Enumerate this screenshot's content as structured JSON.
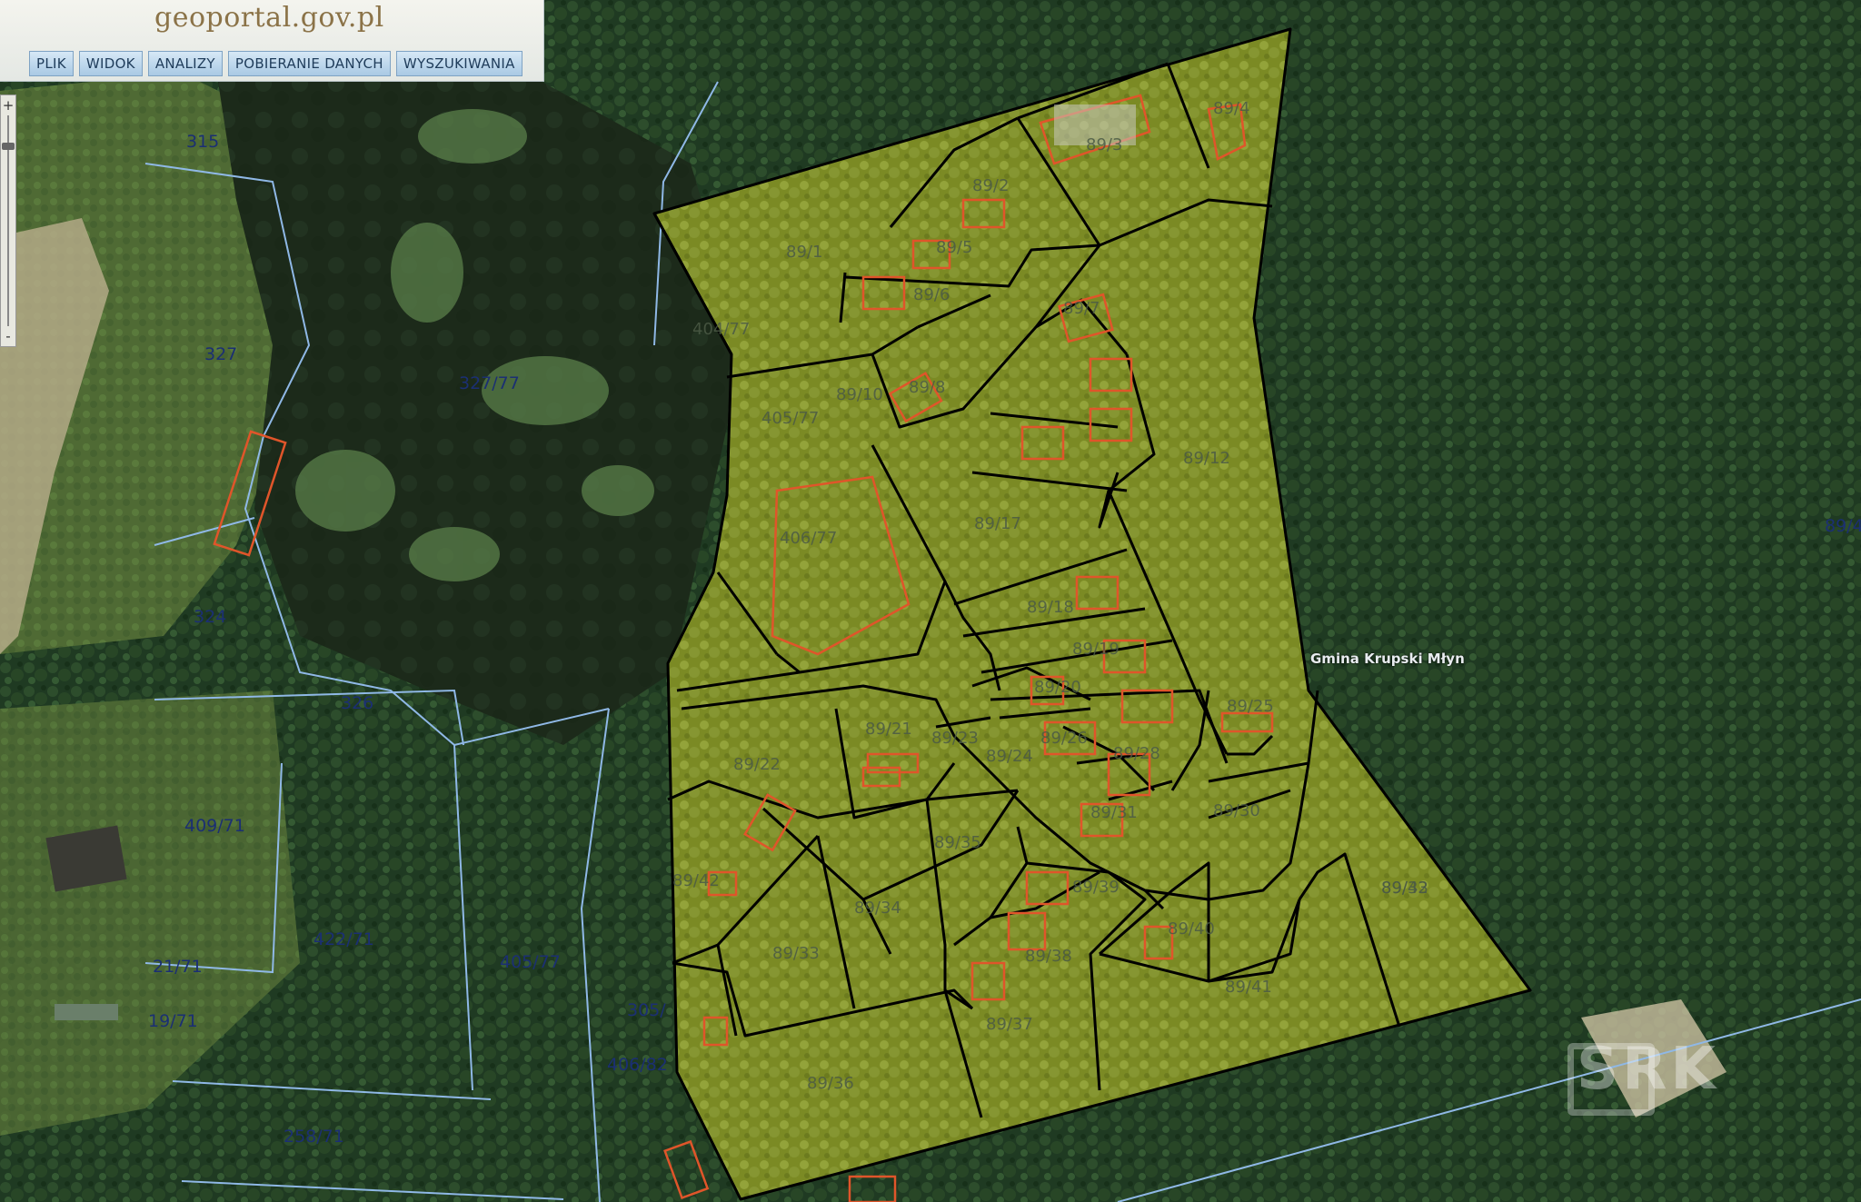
{
  "app": {
    "logo_text": "geoportal.gov.pl",
    "menu": [
      "PLIK",
      "WIDOK",
      "ANALIZY",
      "POBIERANIE DANYCH",
      "WYSZUKIWANIA"
    ],
    "zoom_in": "+",
    "zoom_out": "-"
  },
  "map": {
    "region_label": "Gmina Krupski Młyn",
    "watermark": "SRK",
    "colors": {
      "parcel_fill": "#8a9a28",
      "parcel_border": "#000000",
      "building_outline": "#e0552a",
      "cadastral_line": "#8fb8e6",
      "label_color": "#1b2f73"
    },
    "labels_outside": [
      "315",
      "327",
      "327/77",
      "324",
      "326",
      "409/71",
      "422/71",
      "21/71",
      "19/71",
      "258/71",
      "405/77",
      "406/82",
      "89/4",
      "305/"
    ],
    "labels_inside": [
      "89/1",
      "89/2",
      "89/3",
      "89/4",
      "89/5",
      "89/6",
      "89/7",
      "89/8",
      "89/10",
      "89/12",
      "89/17",
      "89/18",
      "89/19",
      "89/20",
      "89/21",
      "89/22",
      "89/23",
      "89/24",
      "89/25",
      "89/26",
      "89/28",
      "89/30",
      "89/31",
      "89/32",
      "89/33",
      "89/34",
      "89/35",
      "89/36",
      "89/37",
      "89/38",
      "89/39",
      "89/40",
      "89/41",
      "89/42",
      "89/43",
      "404/77",
      "405/77",
      "406/77"
    ]
  }
}
